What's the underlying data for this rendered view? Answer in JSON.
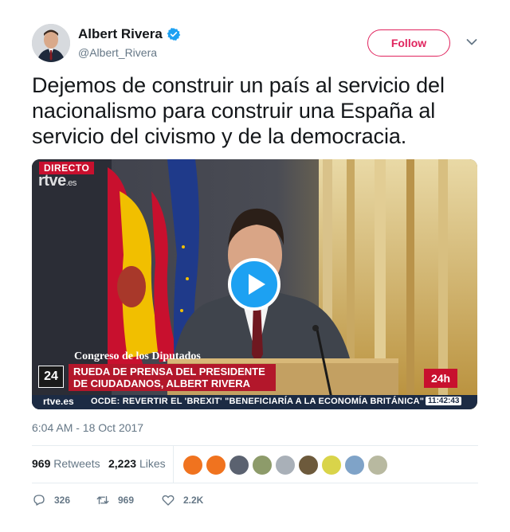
{
  "user": {
    "display_name": "Albert Rivera",
    "handle": "@Albert_Rivera",
    "verified": true
  },
  "follow_button": {
    "label": "Follow",
    "color": "#e0245e"
  },
  "tweet_text": "Dejemos de construir un país al servicio del nacionalismo para construir una España al servicio del civismo y de la democracia.",
  "media": {
    "type": "video",
    "live_tag": "DIRECTO",
    "channel_logo": "rtve",
    "channel_logo_suffix": ".es",
    "venue": "Congreso de los Diputados",
    "headline_line1": "RUEDA DE PRENSA DEL PRESIDENTE",
    "headline_line2": "DE CIUDADANOS, ALBERT RIVERA",
    "channel_number": "24",
    "channel_24h": "24h",
    "ticker_logo": "rtve.es",
    "ticker_text": "OCDE: REVERTIR EL 'BREXIT' \"BENEFICIARÍA A LA ECONOMÍA BRITÁNICA\"",
    "ticker_time": "11:42:43"
  },
  "timestamp": "6:04 AM - 18 Oct 2017",
  "stats": {
    "retweets_count": "969",
    "retweets_label": "Retweets",
    "likes_count": "2,223",
    "likes_label": "Likes"
  },
  "liker_avatar_colors": [
    "#f0731f",
    "#f0731f",
    "#5b6270",
    "#8d9b6a",
    "#a9b0b8",
    "#6d5a3c",
    "#d9d44a",
    "#7fa3c8",
    "#b8b9a0"
  ],
  "actions": {
    "reply_count": "326",
    "retweet_count": "969",
    "like_count": "2.2K"
  },
  "colors": {
    "accent_blue": "#1da1f2",
    "text_primary": "#14171a",
    "text_secondary": "#657786"
  }
}
